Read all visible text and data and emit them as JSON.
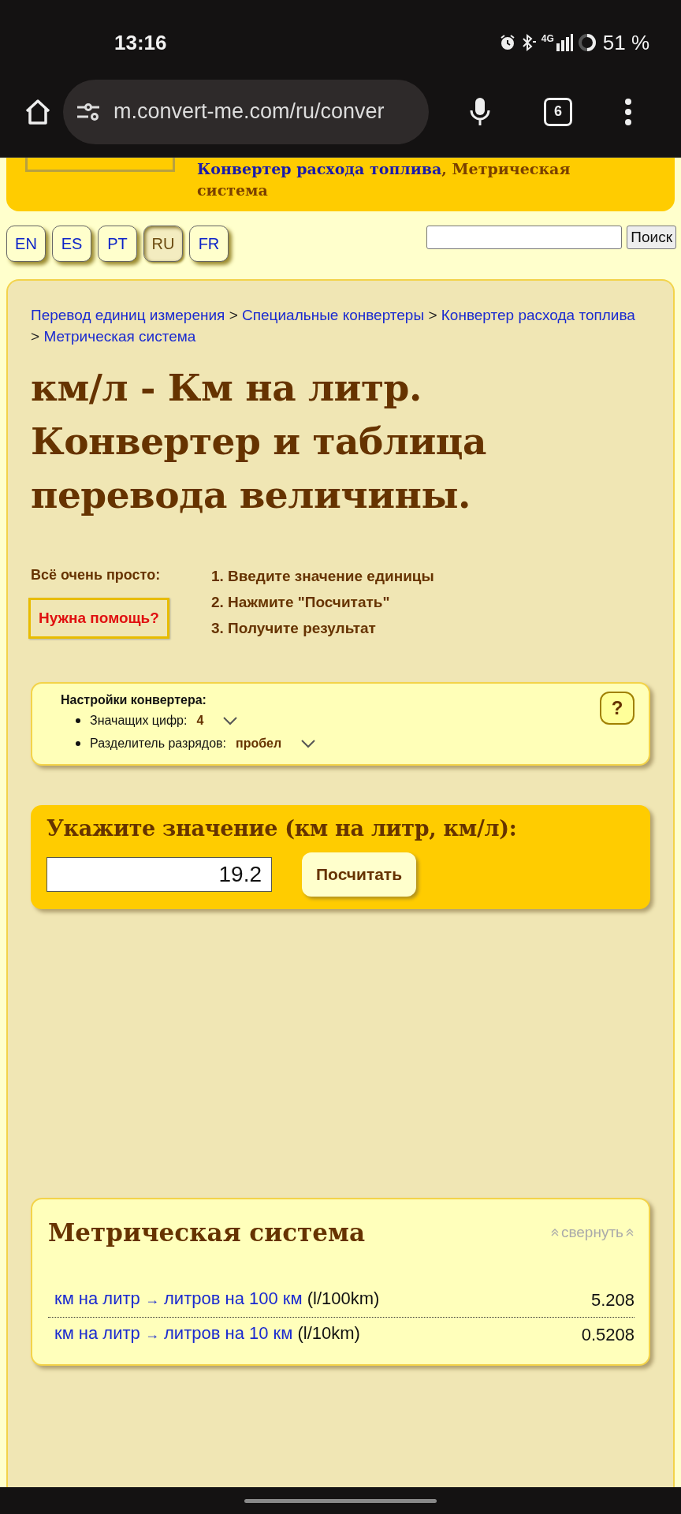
{
  "status_bar": {
    "time": "13:16",
    "network": "4G",
    "battery": "51 %"
  },
  "browser": {
    "url": "m.convert-me.com/ru/conver",
    "tab_count": "6"
  },
  "banner": {
    "link": "Конвертер расхода топлива",
    "rest": ", Метрическая система"
  },
  "languages": [
    {
      "label": "EN",
      "selected": false
    },
    {
      "label": "ES",
      "selected": false
    },
    {
      "label": "PT",
      "selected": false
    },
    {
      "label": "RU",
      "selected": true
    },
    {
      "label": "FR",
      "selected": false
    }
  ],
  "search": {
    "button": "Поиск"
  },
  "breadcrumb": [
    {
      "kind": "link",
      "text": "Перевод единиц измерения"
    },
    {
      "kind": "separator",
      "text": ">"
    },
    {
      "kind": "link",
      "text": "Специальные конвертеры"
    },
    {
      "kind": "separator",
      "text": ">"
    },
    {
      "kind": "link",
      "text": "Конвертер расхода топлива"
    },
    {
      "kind": "separator",
      "text": ">"
    },
    {
      "kind": "link",
      "text": "Метрическая система"
    }
  ],
  "title": "км/л - Км на литр. Конвертер и таблица перевода величины.",
  "howto": {
    "intro": "Всё очень просто:",
    "help_button": "Нужна помощь?",
    "steps": [
      "1. Введите значение единицы",
      "2. Нажмите \"Посчитать\"",
      "3. Получите результат"
    ]
  },
  "settings": {
    "title": "Настройки конвертера:",
    "help": "?",
    "items": [
      {
        "label": "Значащих цифр:",
        "value": "4"
      },
      {
        "label": "Разделитель разрядов:",
        "value": "пробел"
      }
    ]
  },
  "input": {
    "label": "Укажите значение (км на литр, км/л):",
    "value": "19.2",
    "button": "Посчитать"
  },
  "results": {
    "title": "Метрическая система",
    "collapse": "свернуть",
    "rows": [
      {
        "from": "км на литр",
        "arrow": "→",
        "to": "литров на 100 км",
        "unit": "(l/100km)",
        "value": "5.208"
      },
      {
        "from": "км на литр",
        "arrow": "→",
        "to": "литров на 10 км",
        "unit": "(l/10km)",
        "value": "0.5208"
      }
    ]
  }
}
